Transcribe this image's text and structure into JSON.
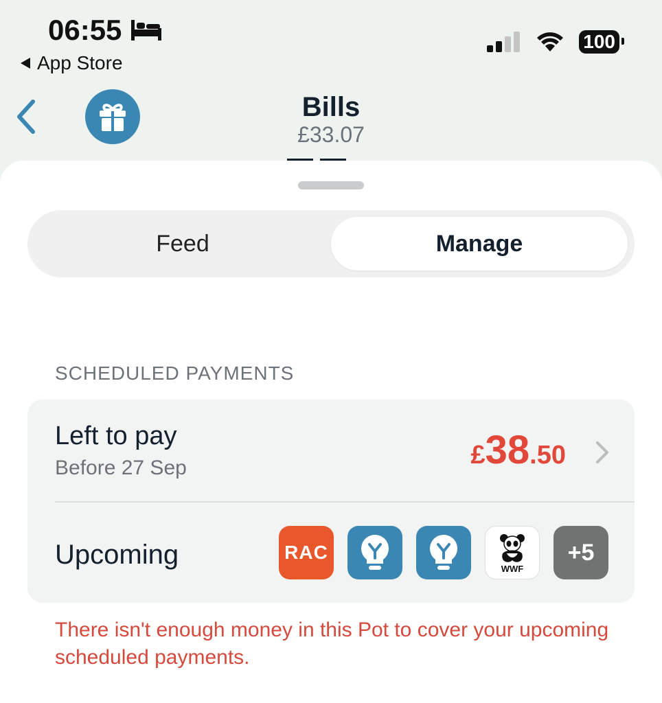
{
  "status_bar": {
    "time": "06:55",
    "back_label": "App Store",
    "battery": "100",
    "icons": [
      "bed-icon",
      "signal-icon",
      "wifi-icon",
      "battery-icon"
    ]
  },
  "header": {
    "title": "Bills",
    "balance": "£33.07",
    "icons": [
      "chevron-left-icon",
      "gift-icon"
    ]
  },
  "tabs": [
    {
      "label": "Feed",
      "active": false
    },
    {
      "label": "Manage",
      "active": true
    }
  ],
  "scheduled": {
    "section_label": "SCHEDULED PAYMENTS",
    "left_to_pay": {
      "title": "Left to pay",
      "subtitle": "Before 27 Sep",
      "amount_currency": "£",
      "amount_major": "38",
      "amount_minor": ".50"
    },
    "upcoming": {
      "label": "Upcoming",
      "logos": [
        {
          "name": "rac",
          "text": "RAC"
        },
        {
          "name": "bulb-energy",
          "text": ""
        },
        {
          "name": "bulb-energy",
          "text": ""
        },
        {
          "name": "wwf",
          "text": "WWF"
        },
        {
          "name": "more",
          "text": "+5"
        }
      ]
    },
    "warning": "There isn't enough money in this Pot to cover your upcoming scheduled payments."
  },
  "colors": {
    "accent_blue": "#3b87b4",
    "warning_red": "#e2483a",
    "rac_orange": "#e8582a"
  }
}
